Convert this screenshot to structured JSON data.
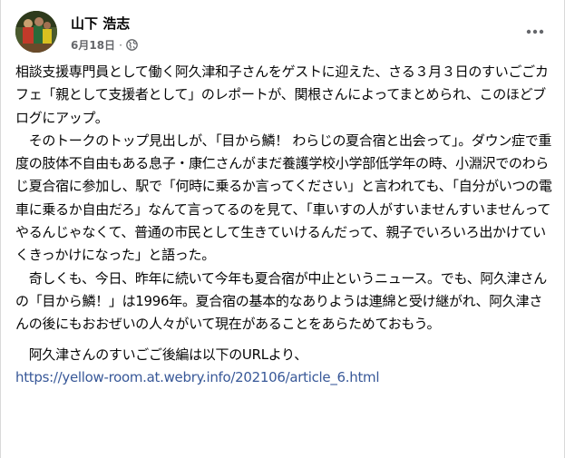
{
  "post": {
    "author": "山下 浩志",
    "date": "6月18日",
    "separator": "·",
    "privacy_icon": "globe-icon",
    "more_icon": "more-options-icon",
    "paragraphs": [
      "相談支援専門員として働く阿久津和子さんをゲストに迎えた、さる３月３日のすいごごカフェ「親として支援者として」のレポートが、関根さんによってまとめられ、このほどブログにアップ。",
      "　そのトークのトップ見出しが、「目から鱗！ わらじの夏合宿と出会って」。ダウン症で重度の肢体不自由もある息子・康仁さんがまだ養護学校小学部低学年の時、小淵沢でのわらじ夏合宿に参加し、駅で「何時に乗るか言ってください」と言われても、「自分がいつの電車に乗るか自由だろ」なんて言ってるのを見て、「車いすの人がすいませんすいませんってやるんじゃなくて、普通の市民として生きていけるんだって、親子でいろいろ出かけていくきっかけになった」と語った。",
      "　奇しくも、今日、昨年に続いて今年も夏合宿が中止というニュース。でも、阿久津さんの「目から鱗！」は1996年。夏合宿の基本的なありようは連綿と受け継がれ、阿久津さんの後にもおおぜいの人々がいて現在があることをあらためておもう。",
      "　阿久津さんのすいごご後編は以下のURLより、"
    ],
    "link": "https://yellow-room.at.webry.info/202106/article_6.html",
    "link_color": "#385898",
    "text_color": "#050505",
    "meta_color": "#65676b"
  }
}
